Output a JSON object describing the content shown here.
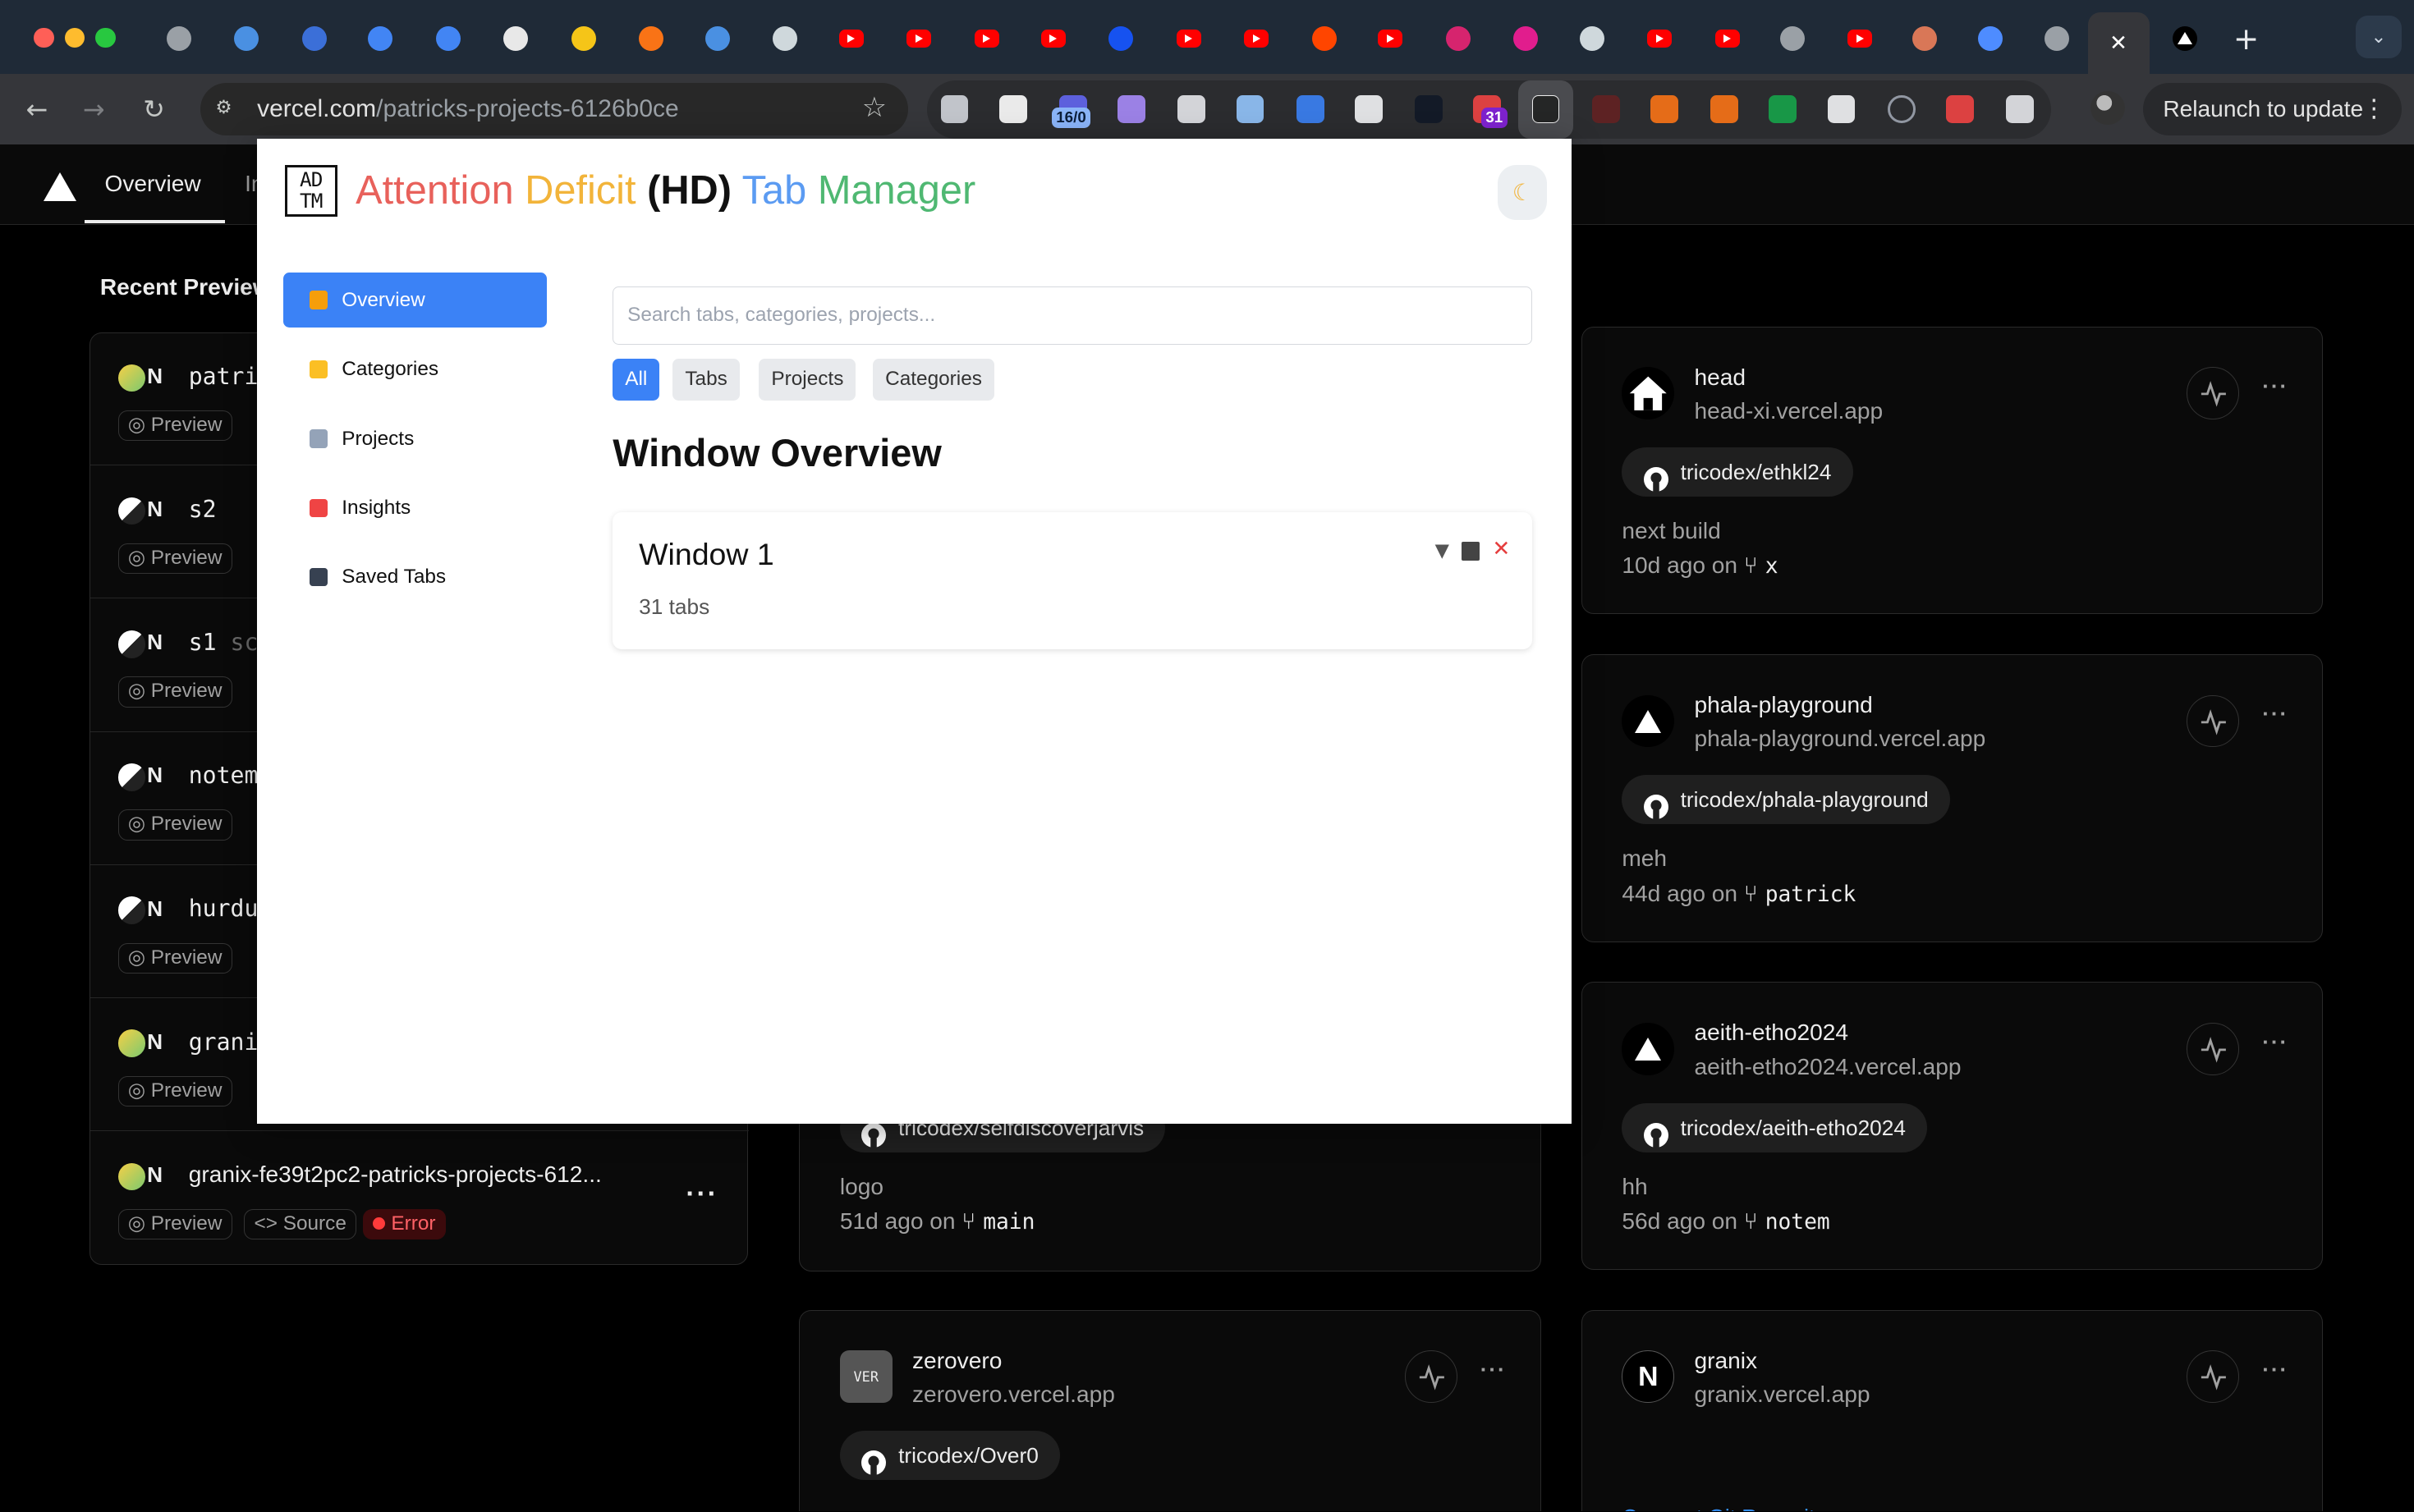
{
  "browser": {
    "url_host": "vercel.com",
    "url_path": "/patricks-projects-6126b0ce",
    "relaunch_label": "Relaunch to update",
    "extension_badges": {
      "counter": "16/0",
      "calendar": "31"
    },
    "tab_close_glyph": "✕",
    "new_tab_glyph": "+",
    "tab_menu_glyph": "⌄",
    "tabs": [
      {
        "icon": "generic-circle-icon"
      },
      {
        "icon": "copilot-icon"
      },
      {
        "icon": "globe-blue-icon"
      },
      {
        "icon": "chrome-icon"
      },
      {
        "icon": "chrome-icon"
      },
      {
        "icon": "panda-icon"
      },
      {
        "icon": "shield-icon"
      },
      {
        "icon": "dots-icon"
      },
      {
        "icon": "copilot-icon"
      },
      {
        "icon": "openai-icon"
      },
      {
        "icon": "youtube-icon"
      },
      {
        "icon": "youtube-icon"
      },
      {
        "icon": "youtube-icon"
      },
      {
        "icon": "youtube-icon"
      },
      {
        "icon": "coinbase-icon"
      },
      {
        "icon": "youtube-icon"
      },
      {
        "icon": "youtube-icon"
      },
      {
        "icon": "reddit-icon"
      },
      {
        "icon": "youtube-icon"
      },
      {
        "icon": "u-icon"
      },
      {
        "icon": "art-icon"
      },
      {
        "icon": "openai-icon"
      },
      {
        "icon": "youtube-icon"
      },
      {
        "icon": "youtube-icon"
      },
      {
        "icon": "globe-icon"
      },
      {
        "icon": "youtube-icon"
      },
      {
        "icon": "claude-icon"
      },
      {
        "icon": "gemini-icon"
      },
      {
        "icon": "globe-icon"
      },
      {
        "icon": "close-icon"
      },
      {
        "icon": "vercel-icon"
      }
    ]
  },
  "vercel": {
    "nav_overview": "Overview",
    "nav_next": "In",
    "recent_title": "Recent Previews",
    "left_rows": [
      {
        "name": "patri",
        "avatar": "gradient"
      },
      {
        "name": "s2",
        "avatar": "bw"
      },
      {
        "name": "s1",
        "suffix": "sc",
        "avatar": "bw"
      },
      {
        "name": "notem",
        "avatar": "bw"
      },
      {
        "name": "hurdu",
        "avatar": "bw"
      },
      {
        "name": "granix",
        "avatar": "gradient"
      },
      {
        "name": "granix-fe39t2pc2-patricks-projects-612...",
        "avatar": "gradient"
      }
    ],
    "preview_label": "Preview",
    "source_label": "Source",
    "error_label": "Error",
    "more_label": "···",
    "cards": [
      {
        "name": "head",
        "url": "head-xi.vercel.app",
        "repo": "tricodex/ethkl24",
        "msg": "next build",
        "ago": "10d ago on",
        "branch": "x"
      },
      {
        "name": "phala-playground",
        "url": "phala-playground.vercel.app",
        "repo": "tricodex/phala-playground",
        "msg": "meh",
        "ago": "44d ago on",
        "branch": "patrick"
      },
      {
        "name": "aeith-etho2024",
        "url": "aeith-etho2024.vercel.app",
        "repo": "tricodex/aeith-etho2024",
        "msg": "hh",
        "ago": "56d ago on",
        "branch": "notem"
      },
      {
        "name": "granix",
        "url": "granix.vercel.app",
        "link": "Connect Git Repository"
      },
      {
        "repo": "tricodex/selfdiscoverjarvis",
        "msg": "logo",
        "ago": "51d ago on",
        "branch": "main"
      },
      {
        "name": "zerovero",
        "url": "zerovero.vercel.app",
        "repo": "tricodex/Over0"
      }
    ]
  },
  "popup": {
    "logo_top": "AD",
    "logo_bottom": "TM",
    "title_attention": "Attention",
    "title_deficit": "Deficit",
    "title_hd": "(HD)",
    "title_tab": "Tab",
    "title_manager": "Manager",
    "theme_icon": "☾",
    "nav": [
      {
        "label": "Overview",
        "icon": "bar-chart-icon",
        "color": "#f59e0b"
      },
      {
        "label": "Categories",
        "icon": "tag-icon",
        "color": "#fbbf24"
      },
      {
        "label": "Projects",
        "icon": "folder-icon",
        "color": "#94a3b8"
      },
      {
        "label": "Insights",
        "icon": "trend-icon",
        "color": "#ef4444"
      },
      {
        "label": "Saved Tabs",
        "icon": "floppy-icon",
        "color": "#374151"
      }
    ],
    "search_placeholder": "Search tabs, categories, projects...",
    "filters": [
      "All",
      "Tabs",
      "Projects",
      "Categories"
    ],
    "section_title": "Window Overview",
    "window": {
      "title": "Window 1",
      "count": "31 tabs",
      "collapse_glyph": "▼",
      "close_glyph": "✕"
    }
  }
}
